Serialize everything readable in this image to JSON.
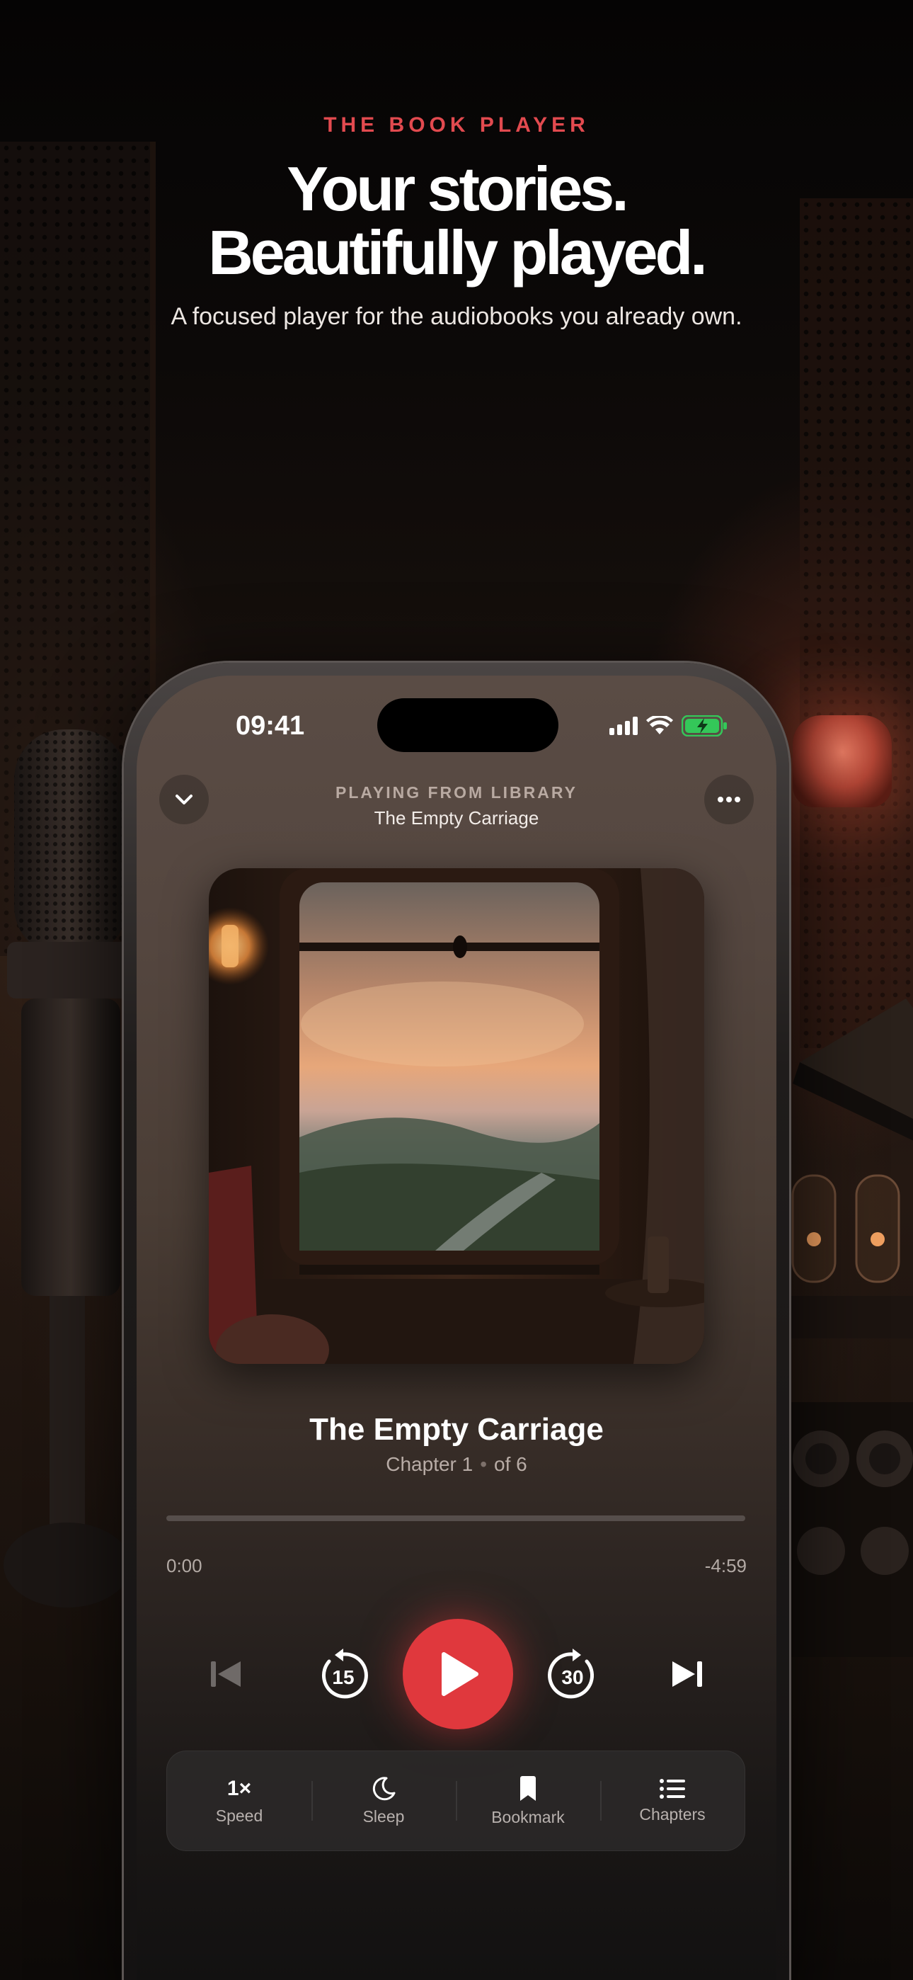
{
  "marketing": {
    "eyebrow": "THE BOOK PLAYER",
    "headline_line1": "Your stories.",
    "headline_line2": "Beautifully played.",
    "subheadline": "A focused player for the audiobooks you already own."
  },
  "status_bar": {
    "time": "09:41",
    "icons": [
      "cellular-signal-icon",
      "wifi-icon",
      "battery-charging-icon"
    ],
    "battery_color": "#34c759"
  },
  "player": {
    "collapse_icon": "chevron-down-icon",
    "more_icon": "ellipsis-icon",
    "playing_from_label": "PLAYING FROM LIBRARY",
    "playing_from_title": "The Empty Carriage",
    "cover_art": "train-window-sunset-illustration",
    "book_title": "The Empty Carriage",
    "chapter_label": "Chapter 1",
    "chapter_separator": "•",
    "chapter_total": "of 6",
    "progress_fraction": 0.0,
    "time_elapsed": "0:00",
    "time_remaining": "-4:59",
    "controls": {
      "previous_icon": "skip-previous-icon",
      "rewind_icon": "rewind-15-icon",
      "rewind_seconds": "15",
      "play_icon": "play-icon",
      "forward_icon": "forward-30-icon",
      "forward_seconds": "30",
      "next_icon": "skip-next-icon"
    },
    "accent_color": "#e0383d",
    "dock": [
      {
        "glyph": "1×",
        "label": "Speed",
        "icon": "speed-icon"
      },
      {
        "glyph": "",
        "label": "Sleep",
        "icon": "moon-icon"
      },
      {
        "glyph": "",
        "label": "Bookmark",
        "icon": "bookmark-icon"
      },
      {
        "glyph": "",
        "label": "Chapters",
        "icon": "list-icon"
      }
    ]
  }
}
